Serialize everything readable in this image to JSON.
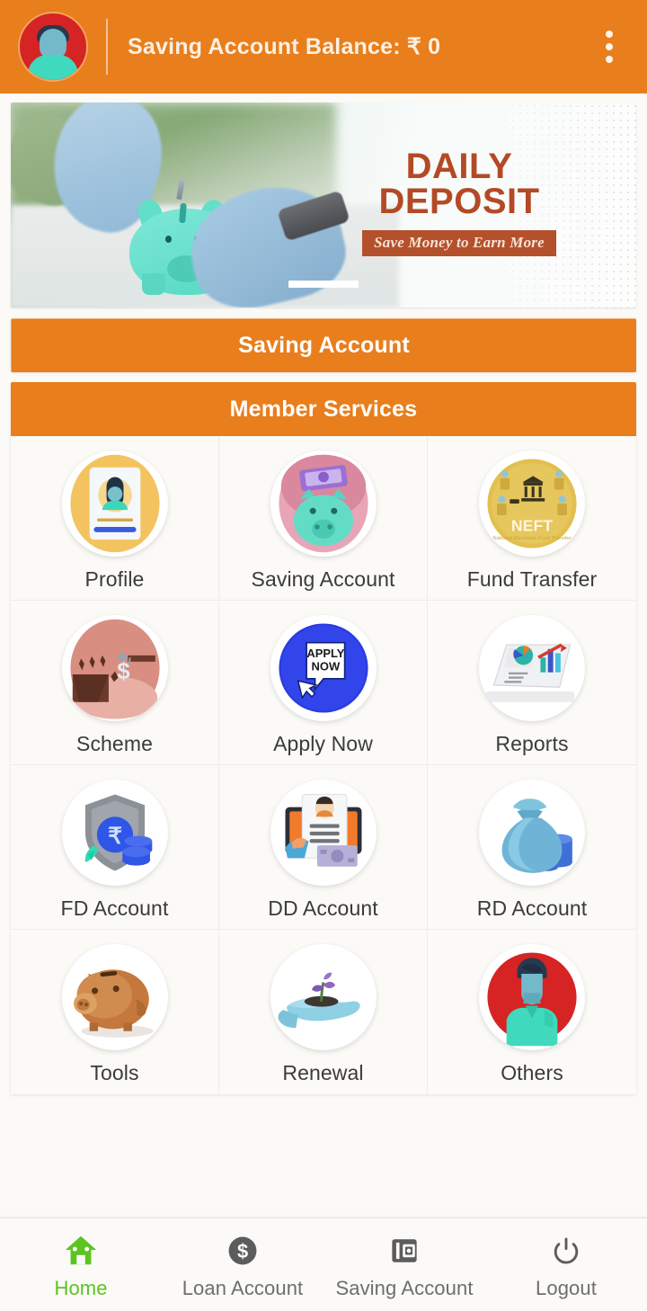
{
  "header": {
    "title": "Saving Account Balance: ₹  0",
    "avatar_alt": "member-avatar",
    "overflow_label": "more-options"
  },
  "banner": {
    "line1": "DAILY",
    "line2": "DEPOSIT",
    "subtitle": "Save Money to Earn More",
    "accent_color": "#b44a25",
    "ribbon_color": "#b4502b"
  },
  "sections": {
    "saving_account_bar": "Saving Account",
    "member_services_bar": "Member Services"
  },
  "services": [
    {
      "label": "Profile",
      "icon": "profile-card-icon"
    },
    {
      "label": "Saving Account",
      "icon": "piggy-bank-money-icon"
    },
    {
      "label": "Fund Transfer",
      "icon": "neft-coin-icon"
    },
    {
      "label": "Scheme",
      "icon": "scheme-cliff-icon"
    },
    {
      "label": "Apply Now",
      "icon": "apply-now-icon"
    },
    {
      "label": "Reports",
      "icon": "reports-chart-icon"
    },
    {
      "label": "FD Account",
      "icon": "shield-rupee-icon"
    },
    {
      "label": "DD Account",
      "icon": "document-cash-icon"
    },
    {
      "label": "RD Account",
      "icon": "money-bag-coins-icon"
    },
    {
      "label": "Tools",
      "icon": "brown-piggy-bank-icon"
    },
    {
      "label": "Renewal",
      "icon": "hand-sprout-icon"
    },
    {
      "label": "Others",
      "icon": "person-avatar-icon"
    }
  ],
  "bottom_nav": {
    "active_color": "#5cc41f",
    "items": [
      {
        "label": "Home",
        "icon": "home-icon",
        "active": true
      },
      {
        "label": "Loan Account",
        "icon": "dollar-coin-icon",
        "active": false
      },
      {
        "label": "Saving Account",
        "icon": "wallet-icon",
        "active": false
      },
      {
        "label": "Logout",
        "icon": "power-icon",
        "active": false
      }
    ]
  },
  "theme": {
    "brand_orange": "#e87e1c",
    "page_background": "#fbfaf7",
    "divider": "#eeece8"
  }
}
